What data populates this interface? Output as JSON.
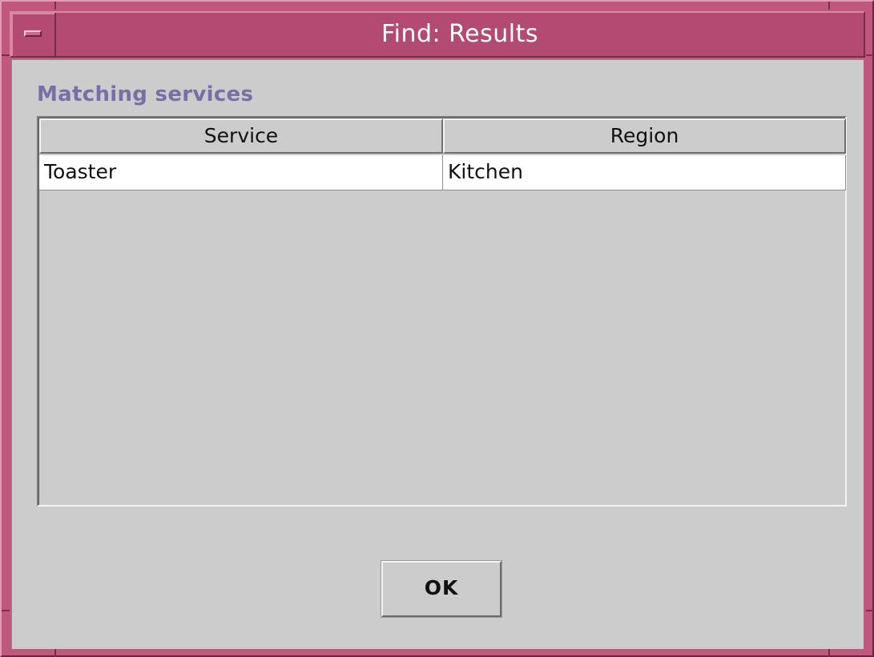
{
  "window": {
    "title": "Find: Results",
    "frame_color": "#c0577d",
    "titlebar_color": "#b24a72"
  },
  "section": {
    "label": "Matching services",
    "label_color": "#7a6ea6"
  },
  "table": {
    "columns": [
      "Service",
      "Region"
    ],
    "rows": [
      [
        "Toaster",
        "Kitchen"
      ]
    ]
  },
  "buttons": {
    "ok_label": "OK"
  },
  "icons": {
    "window_menu": "window-menu-icon"
  }
}
